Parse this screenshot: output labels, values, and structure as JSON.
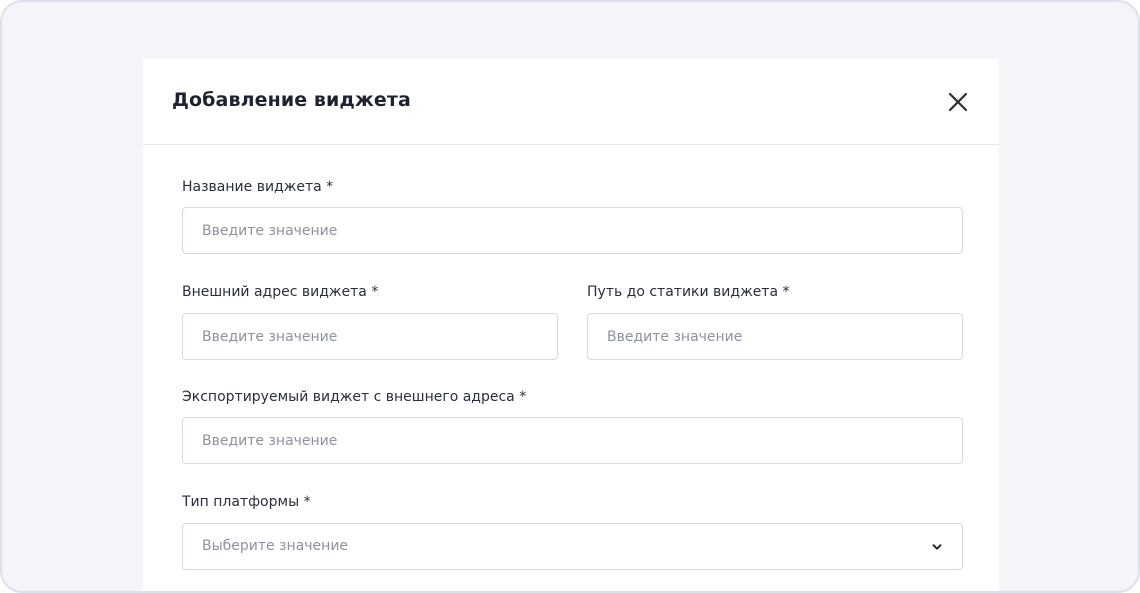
{
  "modal": {
    "title": "Добавление виджета",
    "close_icon": "close-icon"
  },
  "fields": {
    "widget_name": {
      "label": "Название виджета *",
      "placeholder": "Введите значение",
      "value": ""
    },
    "external_address": {
      "label": "Внешний адрес виджета *",
      "placeholder": "Введите значение",
      "value": ""
    },
    "static_path": {
      "label": "Путь до статики виджета *",
      "placeholder": "Введите значение",
      "value": ""
    },
    "exported_widget": {
      "label": "Экспортируемый виджет с внешнего адреса *",
      "placeholder": "Введите значение",
      "value": ""
    },
    "platform_type": {
      "label": "Тип платформы *",
      "placeholder": "Выберите значение",
      "icon": "chevron-down-icon"
    }
  }
}
